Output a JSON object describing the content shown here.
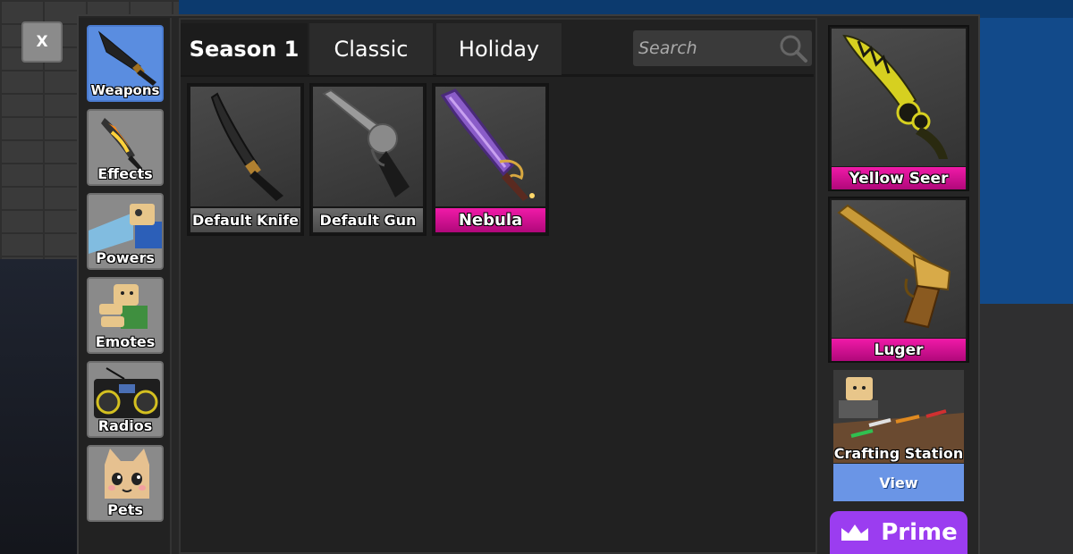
{
  "close_button": {
    "label": "X"
  },
  "categories": [
    {
      "label": "Weapons",
      "icon": "knife-icon",
      "active": true
    },
    {
      "label": "Effects",
      "icon": "flame-knife-icon",
      "active": false
    },
    {
      "label": "Powers",
      "icon": "powers-icon",
      "active": false
    },
    {
      "label": "Emotes",
      "icon": "emote-avatar-icon",
      "active": false
    },
    {
      "label": "Radios",
      "icon": "boombox-icon",
      "active": false
    },
    {
      "label": "Pets",
      "icon": "cat-face-icon",
      "active": false
    }
  ],
  "tabs": [
    {
      "label": "Season 1",
      "active": true
    },
    {
      "label": "Classic",
      "active": false
    },
    {
      "label": "Holiday",
      "active": false
    }
  ],
  "search": {
    "placeholder": "Search",
    "value": ""
  },
  "items": [
    {
      "name": "Default Knife",
      "rarity": "common",
      "icon": "knife-icon"
    },
    {
      "name": "Default Gun",
      "rarity": "common",
      "icon": "revolver-icon"
    },
    {
      "name": "Nebula",
      "rarity": "godly",
      "icon": "nebula-knife-icon"
    }
  ],
  "featured": [
    {
      "name": "Yellow Seer",
      "icon": "yellow-seer-knife-icon"
    },
    {
      "name": "Luger",
      "icon": "luger-gun-icon"
    }
  ],
  "crafting": {
    "title": "Crafting Station",
    "button": "View"
  },
  "prime": {
    "label": "Prime",
    "icon": "crown-icon"
  },
  "colors": {
    "accent_blue": "#5a8de0",
    "godly_pink": "#e0129a",
    "prime_purple": "#9b3df0",
    "panel": "#262626"
  }
}
